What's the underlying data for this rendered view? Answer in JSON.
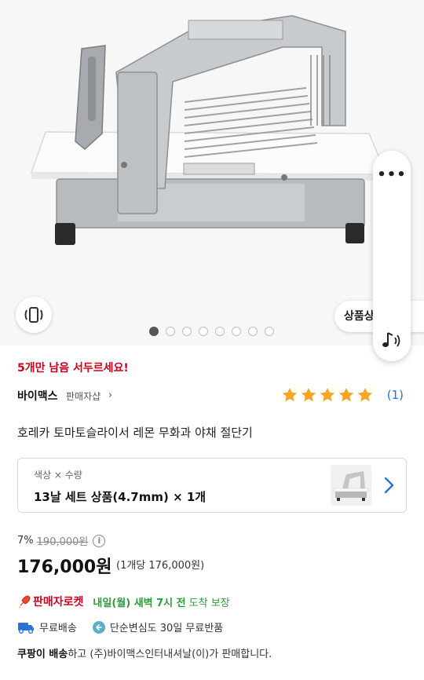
{
  "hero": {
    "detail_button": "상품상",
    "image_count": 8,
    "active_image": 1,
    "more_label": "•••"
  },
  "urgency": "5개만 남음 서두르세요!",
  "seller": {
    "name": "바이맥스",
    "shop_label": "판매자샵",
    "chevron": "›"
  },
  "rating": {
    "stars": 5,
    "review_count": "(1)",
    "star_color": "#f5a623"
  },
  "product_title": "호레카 토마토슬라이서 레몬 무화과 야채 절단기",
  "option": {
    "label": "색상 × 수량",
    "value": "13날 세트 상품(4.7mm) × 1개"
  },
  "price": {
    "discount": "7%",
    "original": "190,000원",
    "current": "176,000원",
    "unit_price": "(1개당 176,000원)",
    "info_icon": "i"
  },
  "delivery": {
    "rocket_label": "판매자로켓",
    "date": "내일(월) 새벽 7시 전",
    "guarantee": "도착 보장",
    "free_shipping": "무료배송",
    "return_text": "단순변심도 30일 무료반품"
  },
  "seller_note": {
    "bold": "쿠팡이 배송",
    "rest": "하고 (주)바이맥스인터내셔날(이)가 판매합니다."
  },
  "colors": {
    "accent_red": "#d0021b",
    "link_blue": "#2a72d8",
    "green": "#2f9a3d"
  }
}
